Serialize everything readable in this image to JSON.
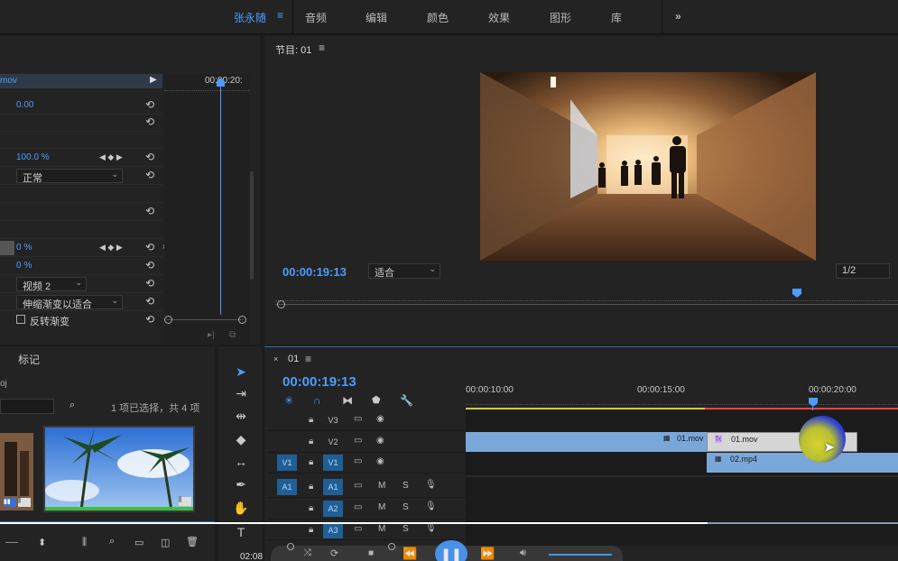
{
  "workspace": {
    "user": "张永随",
    "tabs": [
      "音频",
      "编辑",
      "颜色",
      "效果",
      "图形",
      "库"
    ],
    "more": "»",
    "menu_icon": "hamburger-icon"
  },
  "effect_controls": {
    "clip_name": "mov",
    "ruler_time": "00:00:20:",
    "rows": [
      {
        "value": "0.00"
      },
      {
        "value": "100.0 %"
      },
      {
        "value": "正常"
      },
      {
        "value": "0 %"
      },
      {
        "value": "0 %"
      },
      {
        "value": "视频 2"
      },
      {
        "value": "伸缩渐变以适合"
      },
      {
        "value": "反转渐变"
      }
    ]
  },
  "program_monitor": {
    "title": "节目: 01",
    "timecode": "00:00:19:13",
    "fit": "适合",
    "resolution": "1/2"
  },
  "project_panel": {
    "tab": "标记",
    "name_prefix": "oj",
    "selection_status": "1 项已选择，共 4 项"
  },
  "timeline": {
    "sequence": "01",
    "timecode": "00:00:19:13",
    "ruler": [
      "00:00:10:00",
      "00:00:15:00",
      "00:00:20:00"
    ],
    "tracks": [
      {
        "id": "V3",
        "kind": "video"
      },
      {
        "id": "V2",
        "kind": "video"
      },
      {
        "id": "V1",
        "kind": "video",
        "source": "V1"
      },
      {
        "id": "A1",
        "kind": "audio",
        "source": "A1"
      },
      {
        "id": "A2",
        "kind": "audio"
      },
      {
        "id": "A3",
        "kind": "audio"
      }
    ],
    "clips": [
      {
        "name": "01.mov",
        "track": "V2"
      },
      {
        "name": "01.mov",
        "track": "V2",
        "fx": "fx"
      },
      {
        "name": "02.mp4",
        "track": "V1"
      }
    ]
  },
  "player": {
    "time": "02:08"
  },
  "colors": {
    "accent": "#4d9cff",
    "clip_blue": "#7aa7d9",
    "clip_selected": "#d6d6d6",
    "work_area_yellow": "#d9c53a",
    "work_area_red": "#e0463d"
  }
}
